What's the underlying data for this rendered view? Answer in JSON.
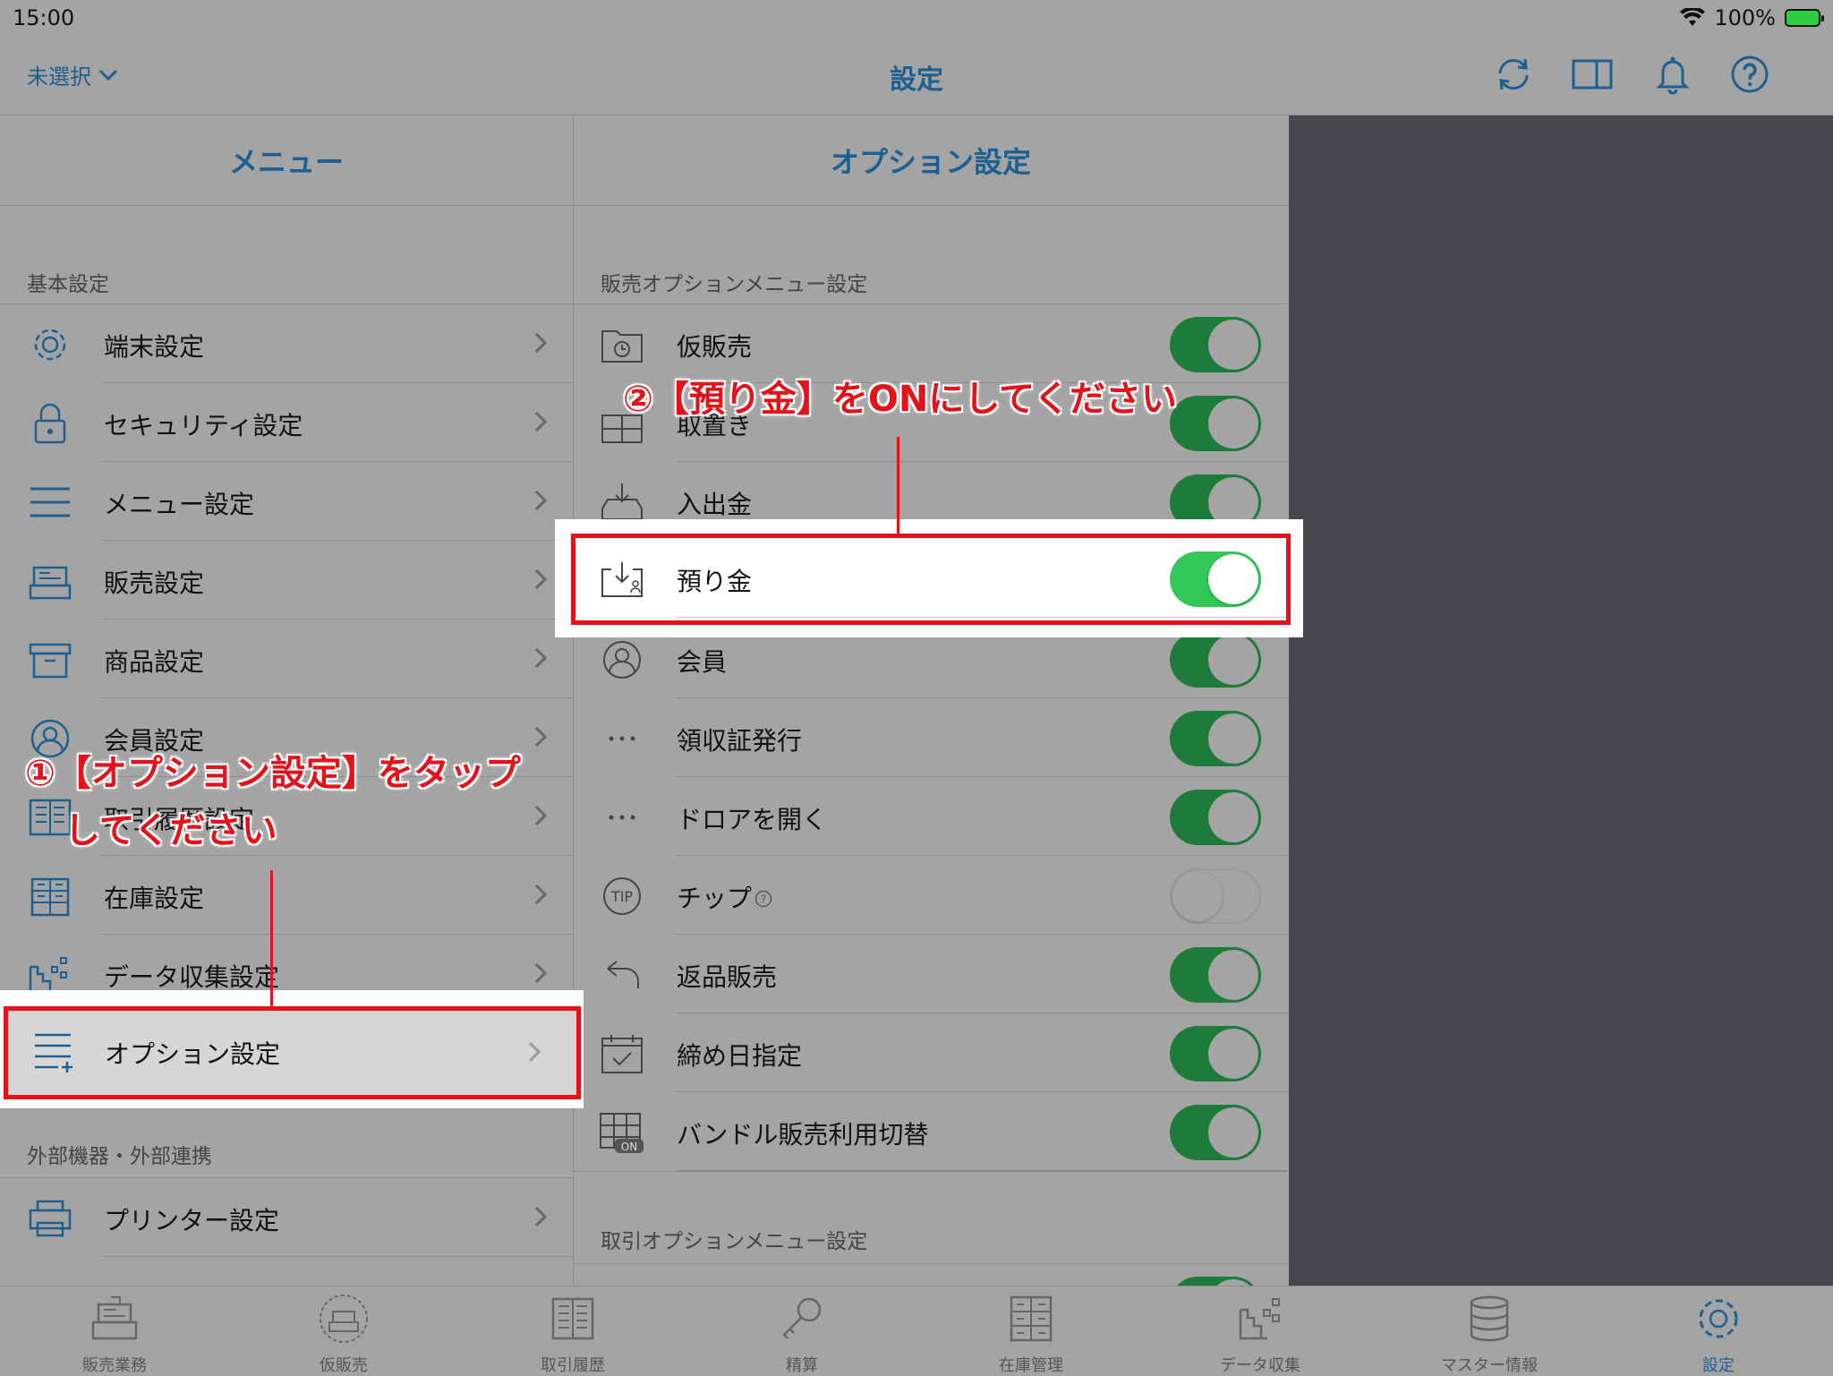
{
  "status_bar": {
    "time": "15:00",
    "battery": "100%"
  },
  "nav": {
    "unselected": "未選択",
    "title": "設定"
  },
  "menu": {
    "header": "メニュー",
    "section_basic": "基本設定",
    "items": [
      {
        "label": "端末設定"
      },
      {
        "label": "セキュリティ設定"
      },
      {
        "label": "メニュー設定"
      },
      {
        "label": "販売設定"
      },
      {
        "label": "商品設定"
      },
      {
        "label": "会員設定"
      },
      {
        "label": "取引履歴設定"
      },
      {
        "label": "在庫設定"
      },
      {
        "label": "データ収集設定"
      },
      {
        "label": "オプション設定"
      }
    ],
    "section_external": "外部機器・外部連携",
    "external_items": [
      {
        "label": "プリンター設定"
      }
    ]
  },
  "options": {
    "header": "オプション設定",
    "section_sales": "販売オプションメニュー設定",
    "items": [
      {
        "label": "仮販売",
        "on": true
      },
      {
        "label": "取置き",
        "on": true
      },
      {
        "label": "入出金",
        "on": true
      },
      {
        "label": "預り金",
        "on": true
      },
      {
        "label": "会員",
        "on": true
      },
      {
        "label": "領収証発行",
        "on": true
      },
      {
        "label": "ドロアを開く",
        "on": true
      },
      {
        "label": "チップ",
        "on": false
      },
      {
        "label": "返品販売",
        "on": true
      },
      {
        "label": "締め日指定",
        "on": true
      },
      {
        "label": "バンドル販売利用切替",
        "on": true
      }
    ],
    "section_transaction": "取引オプションメニュー設定"
  },
  "tabs": [
    {
      "label": "販売業務",
      "icon": "register-icon"
    },
    {
      "label": "仮販売",
      "icon": "temp-sale-icon"
    },
    {
      "label": "取引履歴",
      "icon": "history-icon"
    },
    {
      "label": "精算",
      "icon": "key-icon"
    },
    {
      "label": "在庫管理",
      "icon": "inventory-icon"
    },
    {
      "label": "データ収集",
      "icon": "data-collect-icon"
    },
    {
      "label": "マスター情報",
      "icon": "database-icon"
    },
    {
      "label": "設定",
      "icon": "gear-icon"
    }
  ],
  "annotations": {
    "step1_line1": "①【オプション設定】をタップ",
    "step1_line2": "してください",
    "step2": "②【預り金】をONにしてください"
  },
  "colors": {
    "accent": "#1d5f90",
    "annotation_red": "#e2131a",
    "toggle_on": "#34c759"
  }
}
